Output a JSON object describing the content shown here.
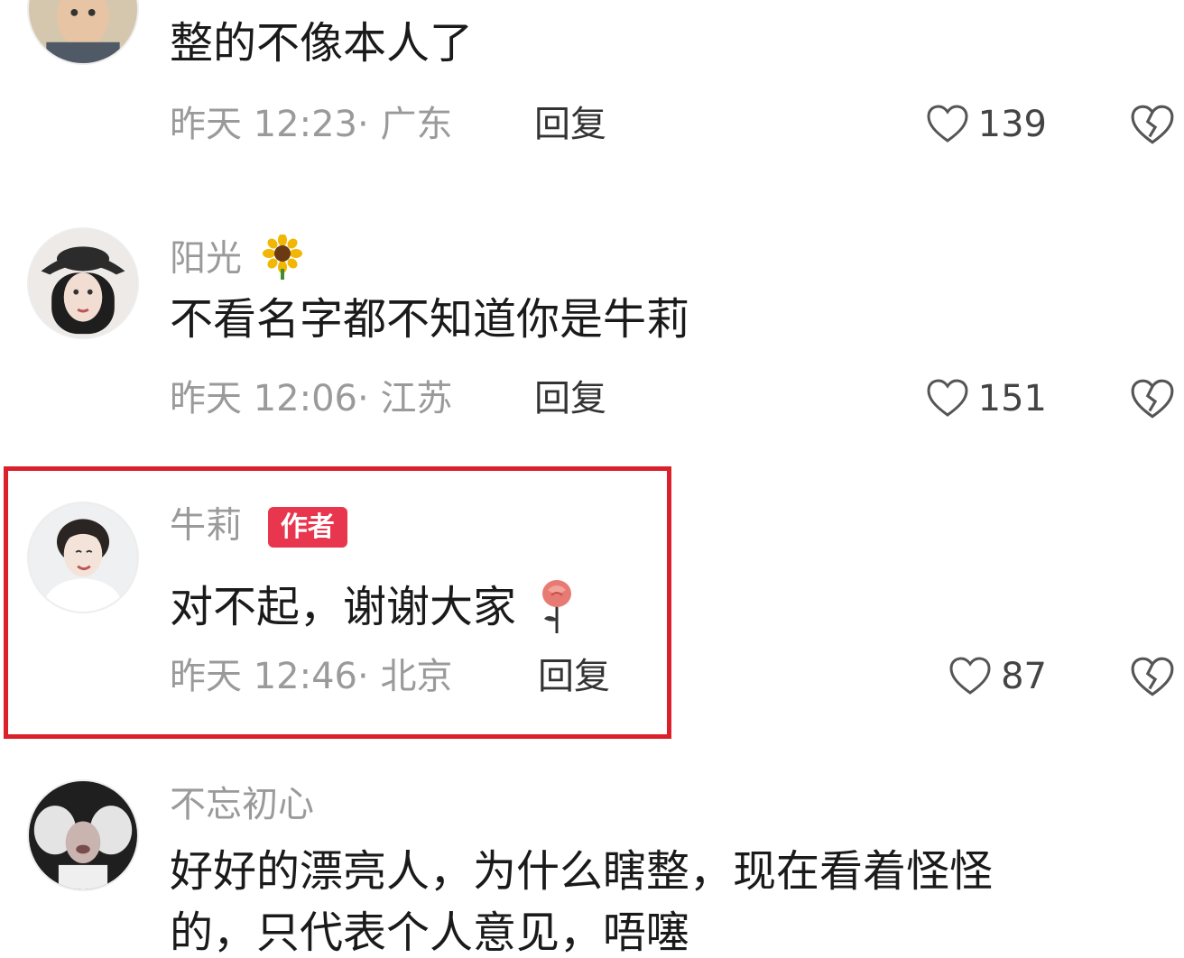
{
  "comments": [
    {
      "username": "",
      "content": "整的不像本人了",
      "time": "昨天 12:23",
      "location": "广东",
      "reply_label": "回复",
      "likes": "139",
      "avatar_color": "#c9b79a"
    },
    {
      "username": "阳光",
      "emoji": "sunflower",
      "content": "不看名字都不知道你是牛莉",
      "time": "昨天 12:06",
      "location": "江苏",
      "reply_label": "回复",
      "likes": "151",
      "avatar_color": "#d8d0cc"
    },
    {
      "username": "牛莉",
      "badge": "作者",
      "emoji": "rose",
      "content": "对不起，谢谢大家",
      "time": "昨天 12:46",
      "location": "北京",
      "reply_label": "回复",
      "likes": "87",
      "avatar_color": "#e3e5e7",
      "highlighted": true
    },
    {
      "username": "不忘初心",
      "content": "好好的漂亮人，为什么瞎整，现在看着怪怪",
      "content_line2": "的，只代表个人意见，唔噻",
      "avatar_color": "#2a2a2a"
    }
  ],
  "colors": {
    "badge": "#e8364f",
    "highlight_border": "#d9202b",
    "meta_text": "#9a9a9a"
  }
}
